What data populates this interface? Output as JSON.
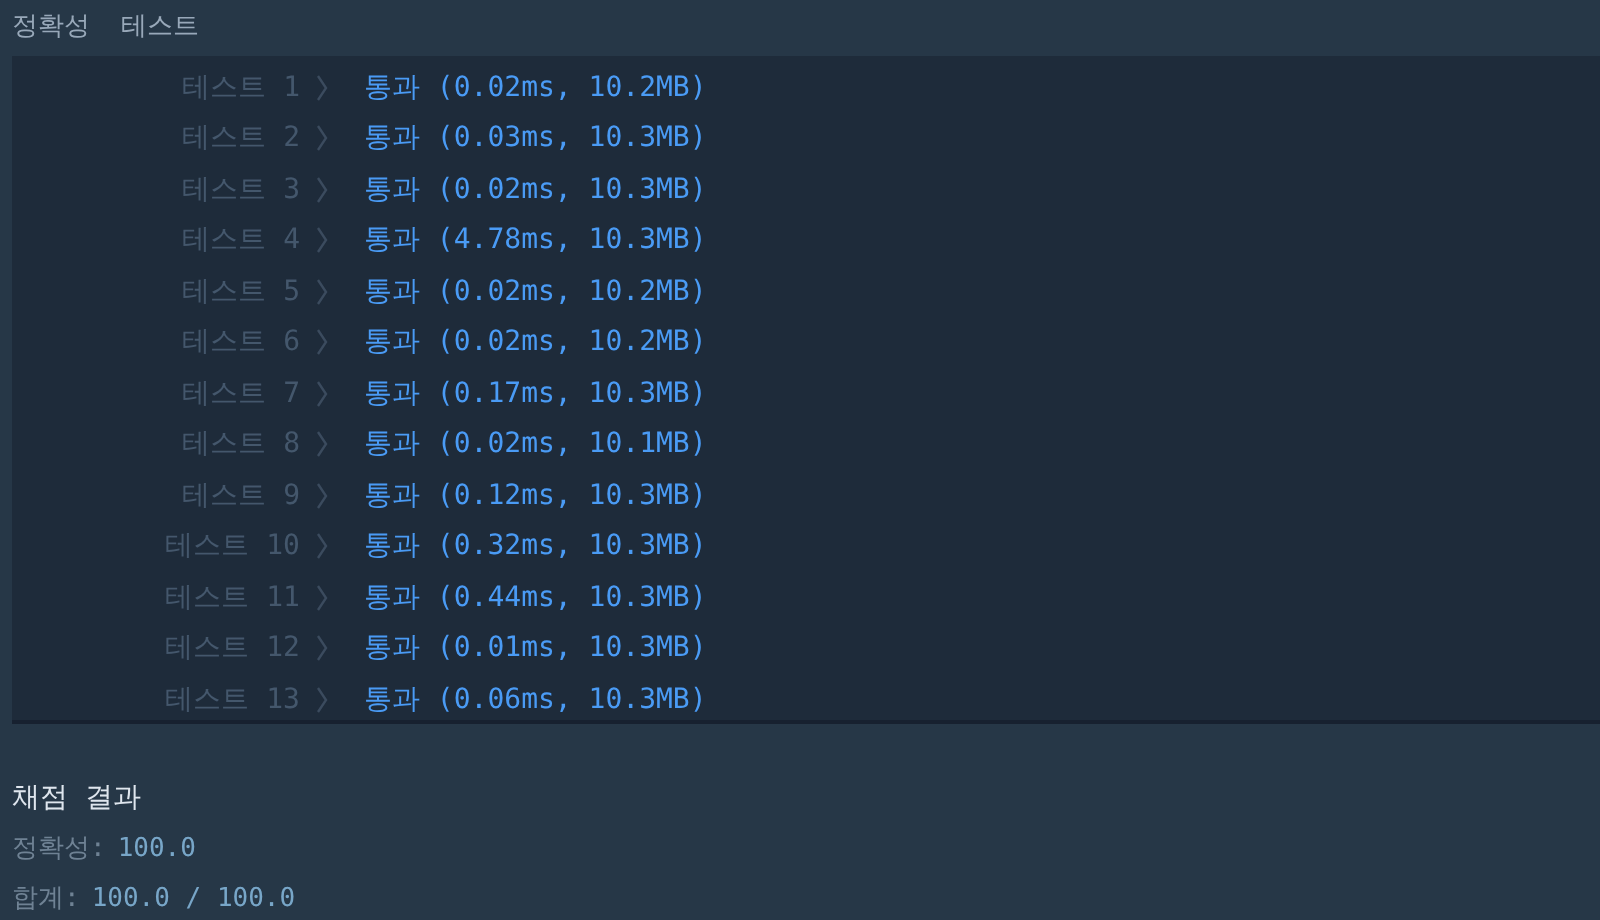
{
  "header": {
    "title": "정확성  테스트"
  },
  "tests": [
    {
      "label": "테스트 1",
      "result": "통과 (0.02ms, 10.2MB)"
    },
    {
      "label": "테스트 2",
      "result": "통과 (0.03ms, 10.3MB)"
    },
    {
      "label": "테스트 3",
      "result": "통과 (0.02ms, 10.3MB)"
    },
    {
      "label": "테스트 4",
      "result": "통과 (4.78ms, 10.3MB)"
    },
    {
      "label": "테스트 5",
      "result": "통과 (0.02ms, 10.2MB)"
    },
    {
      "label": "테스트 6",
      "result": "통과 (0.02ms, 10.2MB)"
    },
    {
      "label": "테스트 7",
      "result": "통과 (0.17ms, 10.3MB)"
    },
    {
      "label": "테스트 8",
      "result": "통과 (0.02ms, 10.1MB)"
    },
    {
      "label": "테스트 9",
      "result": "통과 (0.12ms, 10.3MB)"
    },
    {
      "label": "테스트 10",
      "result": "통과 (0.32ms, 10.3MB)"
    },
    {
      "label": "테스트 11",
      "result": "통과 (0.44ms, 10.3MB)"
    },
    {
      "label": "테스트 12",
      "result": "통과 (0.01ms, 10.3MB)"
    },
    {
      "label": "테스트 13",
      "result": "통과 (0.06ms, 10.3MB)"
    }
  ],
  "summary": {
    "title": "채점 결과",
    "lines": [
      {
        "label": "정확성:",
        "value": "100.0"
      },
      {
        "label": "합계:",
        "value": "100.0 / 100.0"
      }
    ]
  }
}
